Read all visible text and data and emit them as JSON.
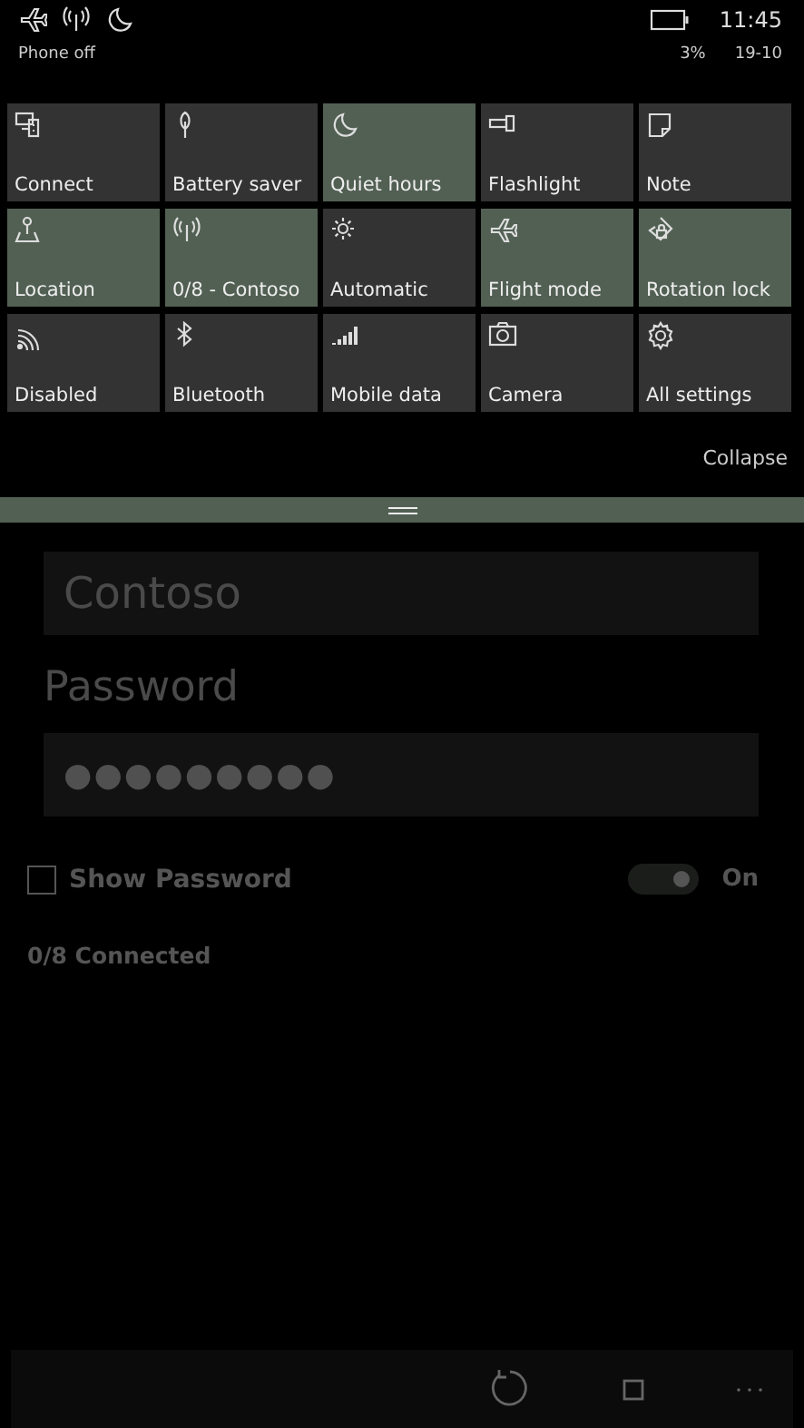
{
  "status_bar": {
    "carrier": "Phone off",
    "time": "11:45",
    "battery_percent": "3%",
    "date": "19-10"
  },
  "quick_actions": [
    {
      "label": "Connect",
      "on": false
    },
    {
      "label": "Battery saver",
      "on": false
    },
    {
      "label": "Quiet hours",
      "on": true
    },
    {
      "label": "Flashlight",
      "on": false
    },
    {
      "label": "Note",
      "on": false
    },
    {
      "label": "Location",
      "on": true
    },
    {
      "label": "0/8 - Contoso",
      "on": true
    },
    {
      "label": "Automatic",
      "on": false
    },
    {
      "label": "Flight mode",
      "on": true
    },
    {
      "label": "Rotation lock",
      "on": true
    },
    {
      "label": "Disabled",
      "on": false
    },
    {
      "label": "Bluetooth",
      "on": false
    },
    {
      "label": "Mobile data",
      "on": false
    },
    {
      "label": "Camera",
      "on": false
    },
    {
      "label": "All settings",
      "on": false
    }
  ],
  "collapse": "Collapse",
  "hotspot": {
    "name_value": "Contoso",
    "password_label": "Password",
    "password_value": "●●●●●●●●●",
    "show_password": {
      "label": "Show Password",
      "checked": false
    },
    "toggle": {
      "on": true,
      "label": "On"
    },
    "connected": "0/8 Connected"
  }
}
